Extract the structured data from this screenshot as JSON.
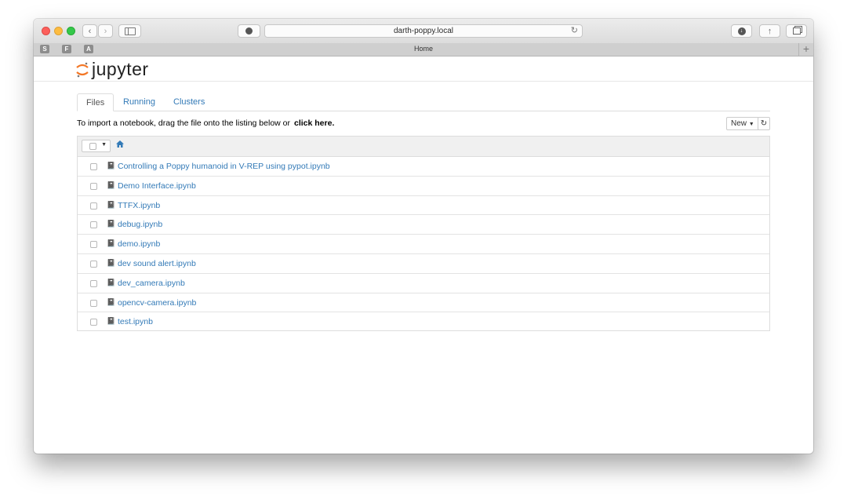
{
  "browser": {
    "url": "darth-poppy.local",
    "tab_title": "Home",
    "favorites": [
      "S",
      "F",
      "A"
    ]
  },
  "jupyter": {
    "logo_text": "jupyter",
    "tabs": [
      {
        "label": "Files",
        "active": true
      },
      {
        "label": "Running",
        "active": false
      },
      {
        "label": "Clusters",
        "active": false
      }
    ],
    "notice_text": "To import a notebook, drag the file onto the listing below or",
    "notice_link": "click here.",
    "new_label": "New",
    "files": [
      "Controlling a Poppy humanoid in V-REP using pypot.ipynb",
      "Demo Interface.ipynb",
      "TTFX.ipynb",
      "debug.ipynb",
      "demo.ipynb",
      "dev sound alert.ipynb",
      "dev_camera.ipynb",
      "opencv-camera.ipynb",
      "test.ipynb"
    ]
  },
  "colors": {
    "link": "#337ab7",
    "jupyter_orange": "#f37726"
  }
}
